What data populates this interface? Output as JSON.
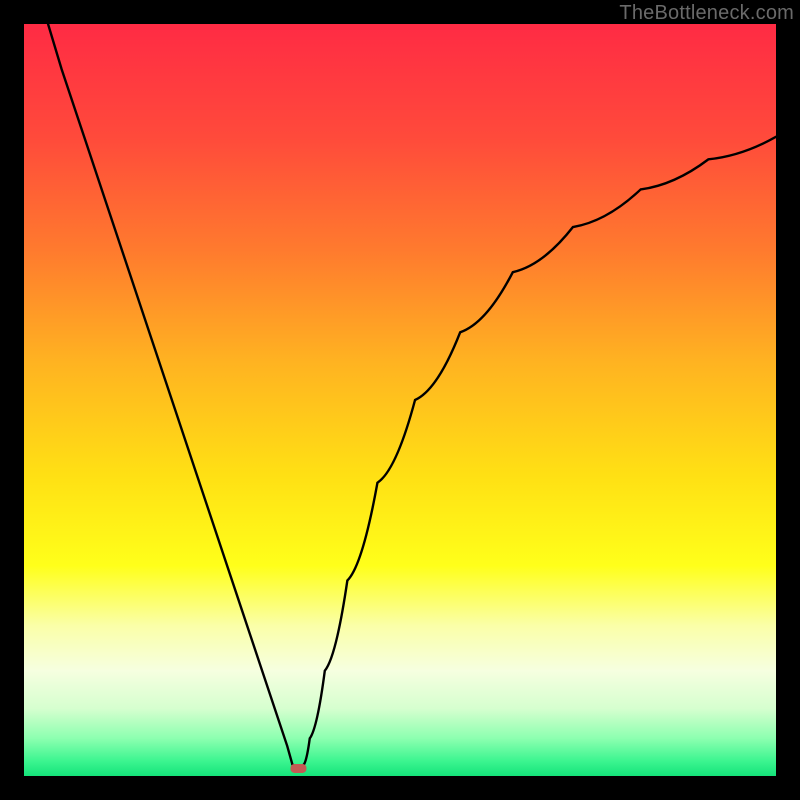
{
  "watermark": "TheBottleneck.com",
  "chart_data": {
    "type": "line",
    "title": "",
    "xlabel": "",
    "ylabel": "",
    "xlim": [
      0,
      100
    ],
    "ylim": [
      0,
      100
    ],
    "minimum_x": 36,
    "gradient_stops": [
      {
        "offset": 0.0,
        "color": "#ff2b44"
      },
      {
        "offset": 0.15,
        "color": "#ff4a3b"
      },
      {
        "offset": 0.3,
        "color": "#ff7a2e"
      },
      {
        "offset": 0.45,
        "color": "#ffb321"
      },
      {
        "offset": 0.6,
        "color": "#ffe014"
      },
      {
        "offset": 0.72,
        "color": "#ffff1a"
      },
      {
        "offset": 0.8,
        "color": "#faffa8"
      },
      {
        "offset": 0.86,
        "color": "#f6ffe0"
      },
      {
        "offset": 0.91,
        "color": "#d6ffcf"
      },
      {
        "offset": 0.95,
        "color": "#8cffb0"
      },
      {
        "offset": 0.98,
        "color": "#3cf590"
      },
      {
        "offset": 1.0,
        "color": "#14e37a"
      }
    ],
    "marker": {
      "x": 36.5,
      "y": 1,
      "color": "#c45a54"
    },
    "series": [
      {
        "name": "left-branch",
        "x": [
          3.2,
          5,
          8,
          11,
          14,
          17,
          20,
          23,
          26,
          29,
          32,
          34,
          35,
          35.7
        ],
        "y": [
          100,
          94,
          85,
          76,
          67,
          58,
          49,
          40,
          31,
          22,
          13,
          7,
          4,
          1.5
        ]
      },
      {
        "name": "right-branch",
        "x": [
          37.2,
          38,
          40,
          43,
          47,
          52,
          58,
          65,
          73,
          82,
          91,
          100
        ],
        "y": [
          1.5,
          5,
          14,
          26,
          39,
          50,
          59,
          67,
          73,
          78,
          82,
          85
        ]
      }
    ]
  }
}
